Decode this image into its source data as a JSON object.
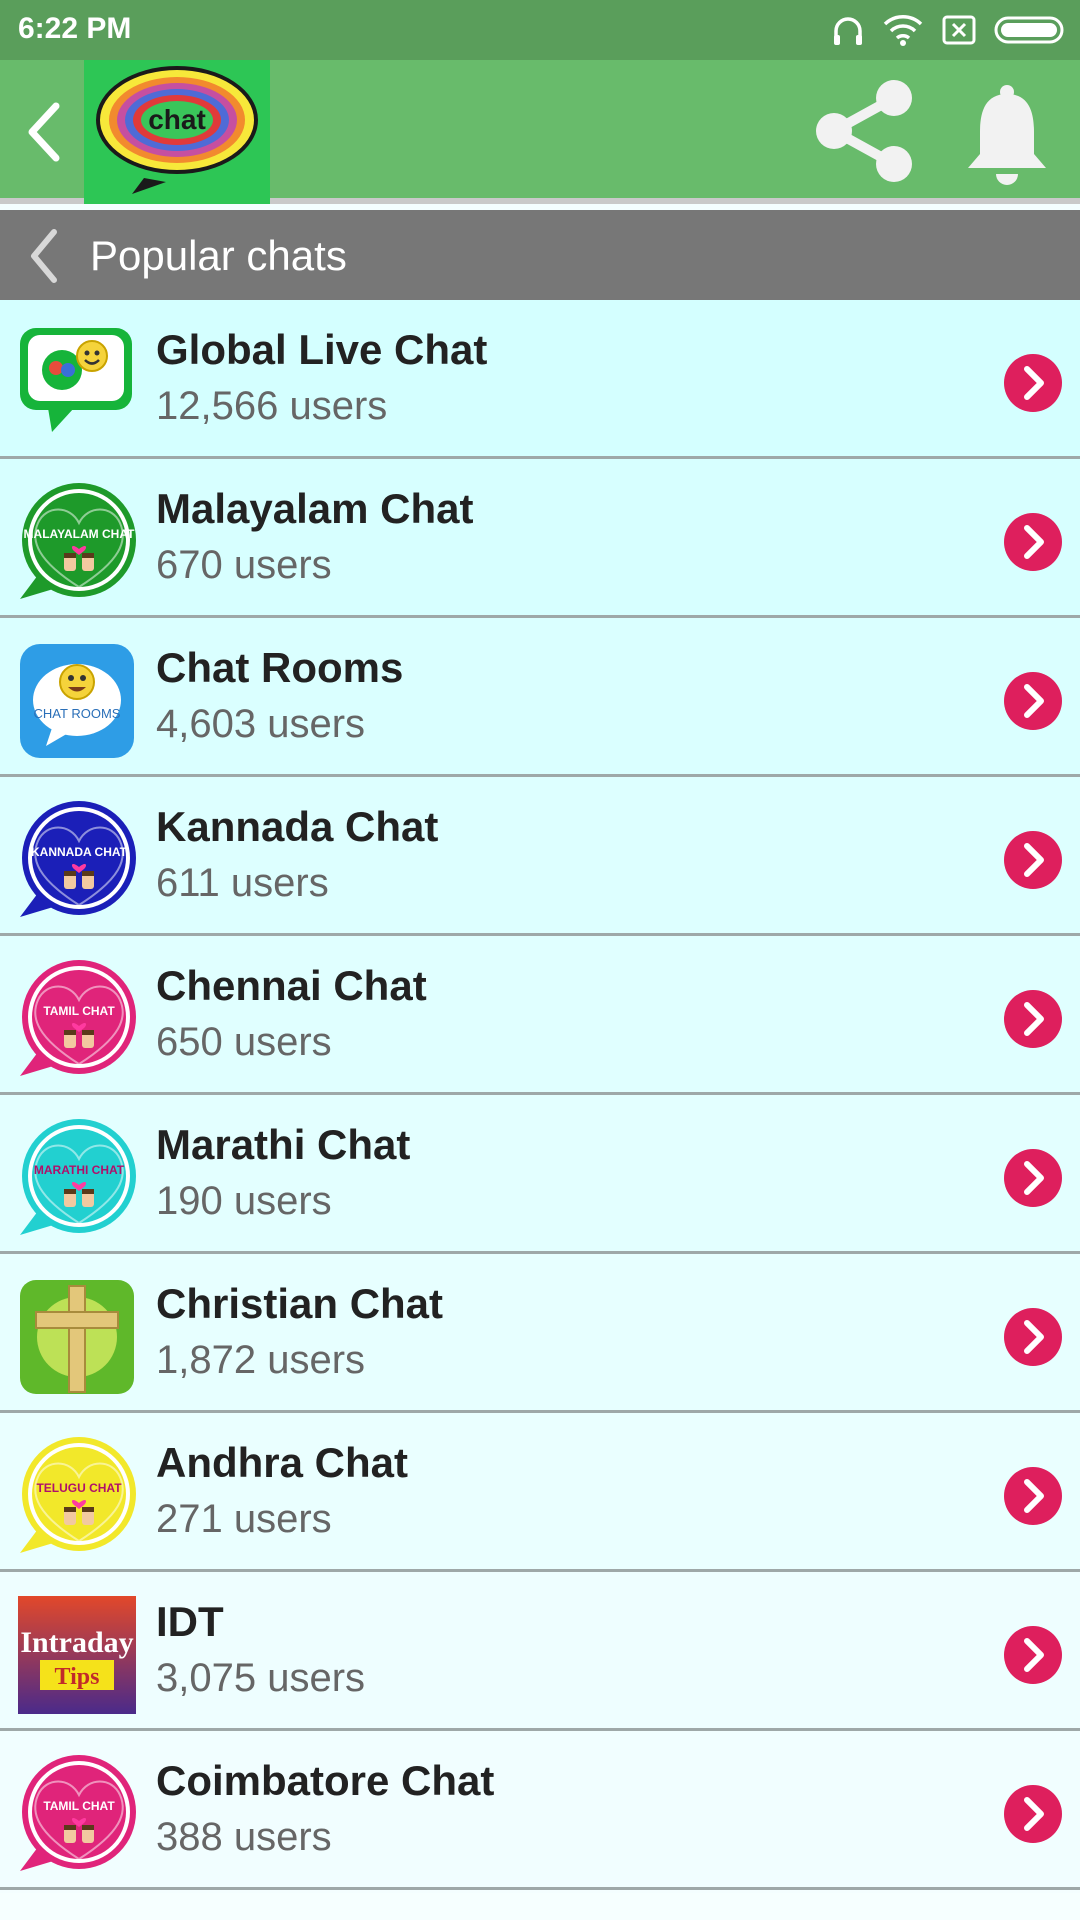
{
  "status_bar": {
    "time": "6:22 PM"
  },
  "app_bar": {
    "logo_text": "chat",
    "colors": {
      "status": "#5a9e5b",
      "bar": "#68bb6b",
      "logo_bg": "#2dc655"
    }
  },
  "section": {
    "title": "Popular chats"
  },
  "chats": [
    {
      "name": "Global Live Chat",
      "users": "12,566 users",
      "row_bg": "#d4ffff",
      "icon": "global-live-chat-icon",
      "icon_color": "#16b43a"
    },
    {
      "name": "Malayalam Chat",
      "users": "670 users",
      "row_bg": "#d7ffff",
      "icon": "malayalam-chat-icon",
      "icon_color": "#1e9a2a",
      "icon_label": "MALAYALAM CHAT"
    },
    {
      "name": "Chat Rooms",
      "users": "4,603 users",
      "row_bg": "#daffff",
      "icon": "chat-rooms-icon",
      "icon_color": "#2e9de6",
      "icon_label": "CHAT ROOMS"
    },
    {
      "name": "Kannada Chat",
      "users": "611 users",
      "row_bg": "#ddffff",
      "icon": "kannada-chat-icon",
      "icon_color": "#1b1fb8",
      "icon_label": "KANNADA CHAT"
    },
    {
      "name": "Chennai Chat",
      "users": "650 users",
      "row_bg": "#e0ffff",
      "icon": "tamil-chat-icon",
      "icon_color": "#e0247a",
      "icon_label": "TAMIL CHAT"
    },
    {
      "name": "Marathi Chat",
      "users": "190 users",
      "row_bg": "#e3ffff",
      "icon": "marathi-chat-icon",
      "icon_color": "#22d0d0",
      "icon_label": "MARATHI CHAT"
    },
    {
      "name": "Christian Chat",
      "users": "1,872 users",
      "row_bg": "#e7ffff",
      "icon": "christian-cross-icon",
      "icon_color": "#5fb82a"
    },
    {
      "name": "Andhra Chat",
      "users": "271 users",
      "row_bg": "#eaffff",
      "icon": "telugu-chat-icon",
      "icon_color": "#f2e82a",
      "icon_label": "TELUGU CHAT"
    },
    {
      "name": "IDT",
      "users": "3,075 users",
      "row_bg": "#eefeff",
      "icon": "intraday-tips-icon",
      "icon_color": "#d84a2a",
      "icon_label": "Intraday Tips"
    },
    {
      "name": "Coimbatore Chat",
      "users": "388 users",
      "row_bg": "#f1feff",
      "icon": "tamil-chat-icon",
      "icon_color": "#e0247a",
      "icon_label": "TAMIL CHAT"
    }
  ],
  "accent": "#de1f5d"
}
